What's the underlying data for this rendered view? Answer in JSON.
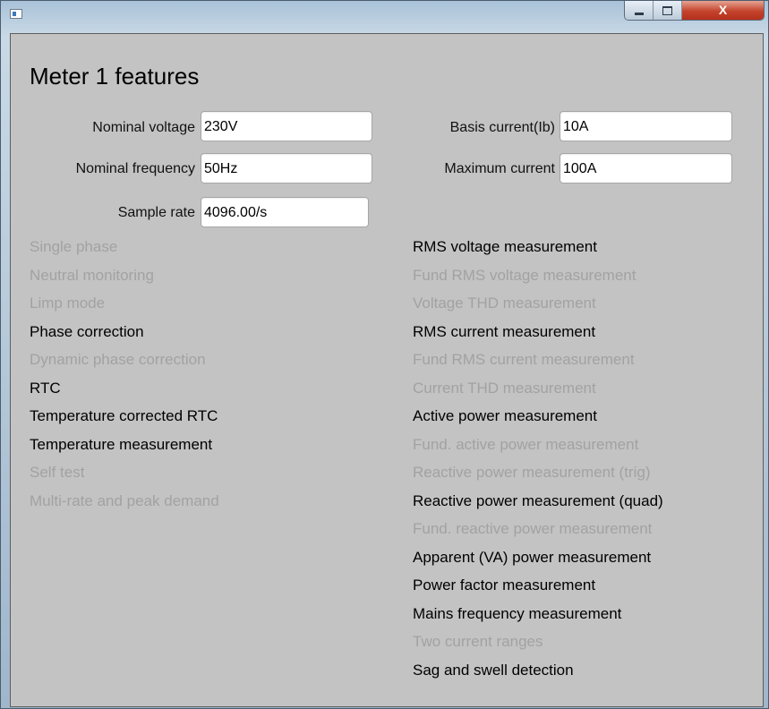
{
  "window": {
    "controls": {
      "close_label": "X"
    }
  },
  "page": {
    "heading": "Meter 1 features"
  },
  "fields": [
    {
      "label": "Nominal voltage",
      "value": "230V"
    },
    {
      "label": "Basis current(Ib)",
      "value": "10A"
    },
    {
      "label": "Nominal frequency",
      "value": "50Hz"
    },
    {
      "label": "Maximum current",
      "value": "100A"
    },
    {
      "label": "Sample rate",
      "value": "4096.00/s"
    }
  ],
  "left_features": [
    {
      "label": "Single phase",
      "enabled": false
    },
    {
      "label": "Neutral monitoring",
      "enabled": false
    },
    {
      "label": "Limp mode",
      "enabled": false
    },
    {
      "label": "Phase correction",
      "enabled": true
    },
    {
      "label": "Dynamic phase correction",
      "enabled": false
    },
    {
      "label": "RTC",
      "enabled": true
    },
    {
      "label": "Temperature corrected RTC",
      "enabled": true
    },
    {
      "label": "Temperature measurement",
      "enabled": true
    },
    {
      "label": "Self test",
      "enabled": false
    },
    {
      "label": "Multi-rate and peak demand",
      "enabled": false
    }
  ],
  "right_features": [
    {
      "label": "RMS voltage measurement",
      "enabled": true
    },
    {
      "label": "Fund RMS voltage measurement",
      "enabled": false
    },
    {
      "label": "Voltage THD measurement",
      "enabled": false
    },
    {
      "label": "RMS current measurement",
      "enabled": true
    },
    {
      "label": "Fund RMS current measurement",
      "enabled": false
    },
    {
      "label": "Current THD measurement",
      "enabled": false
    },
    {
      "label": "Active power measurement",
      "enabled": true
    },
    {
      "label": "Fund. active power measurement",
      "enabled": false
    },
    {
      "label": "Reactive power measurement (trig)",
      "enabled": false
    },
    {
      "label": "Reactive power measurement (quad)",
      "enabled": true
    },
    {
      "label": "Fund. reactive power measurement",
      "enabled": false
    },
    {
      "label": "Apparent (VA) power measurement",
      "enabled": true
    },
    {
      "label": "Power factor measurement",
      "enabled": true
    },
    {
      "label": "Mains frequency measurement",
      "enabled": true
    },
    {
      "label": "Two current ranges",
      "enabled": false
    },
    {
      "label": "Sag and swell detection",
      "enabled": true
    }
  ]
}
